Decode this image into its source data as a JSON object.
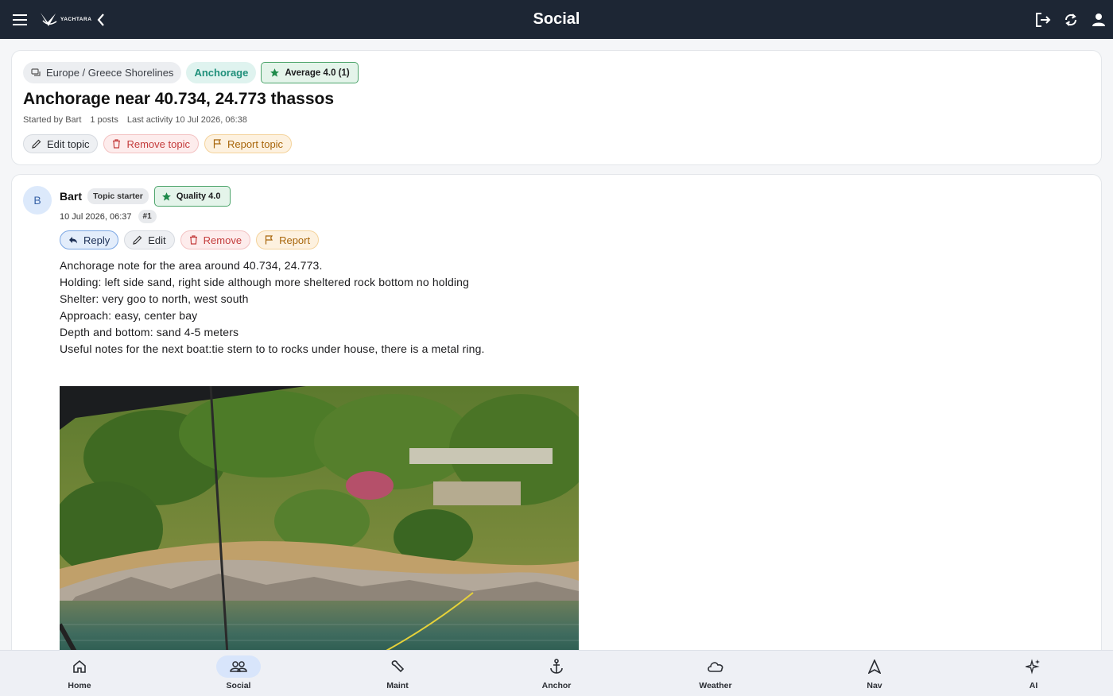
{
  "app": {
    "title": "Social",
    "logo_text": "YACHTARA"
  },
  "topic": {
    "category": "Europe / Greece Shorelines",
    "tag": "Anchorage",
    "rating": "Average 4.0 (1)",
    "title": "Anchorage near 40.734, 24.773 thassos",
    "started_by": "Started by Bart",
    "posts": "1 posts",
    "last_activity": "Last activity 10 Jul 2026, 06:38",
    "actions": {
      "edit": "Edit topic",
      "remove": "Remove topic",
      "report": "Report topic"
    }
  },
  "post": {
    "avatar_initial": "B",
    "author": "Bart",
    "role_badge": "Topic starter",
    "quality": "Quality 4.0",
    "timestamp": "10 Jul 2026, 06:37",
    "number": "#1",
    "actions": {
      "reply": "Reply",
      "edit": "Edit",
      "remove": "Remove",
      "report": "Report"
    },
    "body": [
      "Anchorage note for the area around 40.734, 24.773.",
      "",
      "Holding: left side sand, right side although more sheltered rock bottom no holding",
      "Shelter: very goo to north, west south",
      "Approach: easy, center bay",
      "Depth and bottom: sand 4-5 meters",
      "Useful notes for the next boat:tie stern to to rocks under house, there is a metal ring."
    ]
  },
  "bottom_nav": {
    "items": [
      {
        "label": "Home",
        "icon": "home-icon"
      },
      {
        "label": "Social",
        "icon": "people-icon",
        "active": true
      },
      {
        "label": "Maint",
        "icon": "wrench-icon"
      },
      {
        "label": "Anchor",
        "icon": "anchor-icon"
      },
      {
        "label": "Weather",
        "icon": "cloud-icon"
      },
      {
        "label": "Nav",
        "icon": "navigation-arrow-icon"
      },
      {
        "label": "AI",
        "icon": "sparkle-icon"
      }
    ]
  },
  "colors": {
    "appbar": "#1d2634",
    "accent_teal": "#1f8f7a",
    "danger": "#c43c3c",
    "warning": "#a8660b",
    "rating_green": "#4ea56c"
  }
}
